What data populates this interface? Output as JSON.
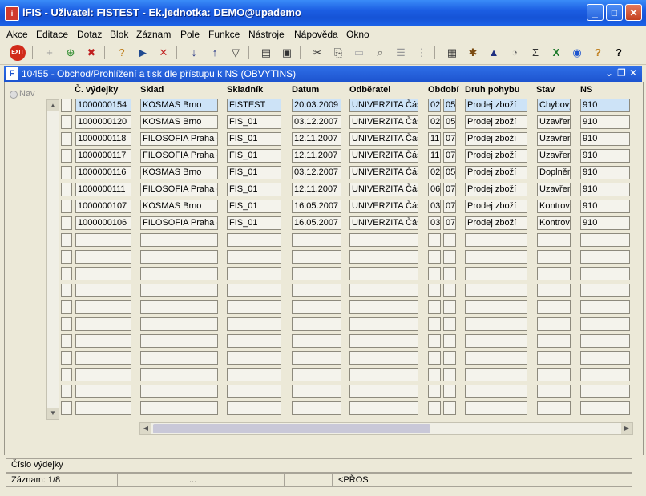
{
  "window": {
    "title": "iFIS - Uživatel: FISTEST - Ek.jednotka: DEMO@upademo"
  },
  "menu": [
    "Akce",
    "Editace",
    "Dotaz",
    "Blok",
    "Záznam",
    "Pole",
    "Funkce",
    "Nástroje",
    "Nápověda",
    "Okno"
  ],
  "form": {
    "title": "10455 - Obchod/Prohlížení a tisk dle přístupu k NS (OBVYTINS)",
    "nav_label": "Nav"
  },
  "columns": {
    "vydejka": "Č. výdejky",
    "sklad": "Sklad",
    "skladnik": "Skladník",
    "datum": "Datum",
    "odberatel": "Odběratel",
    "obdobi": "Období",
    "druh": "Druh pohybu",
    "stav": "Stav",
    "ns": "NS"
  },
  "rows": [
    {
      "vydejka": "1000000154",
      "sklad": "KOSMAS Brno",
      "skladnik": "FISTEST",
      "datum": "20.03.2009",
      "odberatel": "UNIVERZITA Část",
      "m": "02",
      "r": "05",
      "druh": "Prodej zboží",
      "stav": "Chybový",
      "ns": "910"
    },
    {
      "vydejka": "1000000120",
      "sklad": "KOSMAS Brno",
      "skladnik": "FIS_01",
      "datum": "03.12.2007",
      "odberatel": "UNIVERZITA Část",
      "m": "02",
      "r": "05",
      "druh": "Prodej zboží",
      "stav": "Uzavřen",
      "ns": "910"
    },
    {
      "vydejka": "1000000118",
      "sklad": "FILOSOFIA Praha -",
      "skladnik": "FIS_01",
      "datum": "12.11.2007",
      "odberatel": "UNIVERZITA Část",
      "m": "11",
      "r": "07",
      "druh": "Prodej zboží",
      "stav": "Uzavřen",
      "ns": "910"
    },
    {
      "vydejka": "1000000117",
      "sklad": "FILOSOFIA Praha -",
      "skladnik": "FIS_01",
      "datum": "12.11.2007",
      "odberatel": "UNIVERZITA Část",
      "m": "11",
      "r": "07",
      "druh": "Prodej zboží",
      "stav": "Uzavřen",
      "ns": "910"
    },
    {
      "vydejka": "1000000116",
      "sklad": "KOSMAS Brno",
      "skladnik": "FIS_01",
      "datum": "03.12.2007",
      "odberatel": "UNIVERZITA Část",
      "m": "02",
      "r": "05",
      "druh": "Prodej zboží",
      "stav": "Doplněn",
      "ns": "910"
    },
    {
      "vydejka": "1000000111",
      "sklad": "FILOSOFIA Praha -",
      "skladnik": "FIS_01",
      "datum": "12.11.2007",
      "odberatel": "UNIVERZITA Část",
      "m": "06",
      "r": "07",
      "druh": "Prodej zboží",
      "stav": "Uzavřen",
      "ns": "910"
    },
    {
      "vydejka": "1000000107",
      "sklad": "KOSMAS Brno",
      "skladnik": "FIS_01",
      "datum": "16.05.2007",
      "odberatel": "UNIVERZITA Část",
      "m": "03",
      "r": "07",
      "druh": "Prodej zboží",
      "stav": "Kontrové",
      "ns": "910"
    },
    {
      "vydejka": "1000000106",
      "sklad": "FILOSOFIA Praha -",
      "skladnik": "FIS_01",
      "datum": "16.05.2007",
      "odberatel": "UNIVERZITA Část",
      "m": "03",
      "r": "07",
      "druh": "Prodej zboží",
      "stav": "Kontrové",
      "ns": "910"
    }
  ],
  "status": {
    "hint": "Číslo výdejky",
    "record": "Záznam: 1/8",
    "ellipsis": "...",
    "mode": "<PŘOS"
  }
}
